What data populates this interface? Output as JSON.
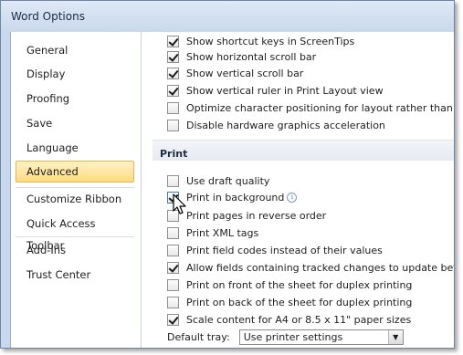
{
  "window": {
    "title": "Word Options"
  },
  "sidebar": {
    "items": [
      {
        "label": "General"
      },
      {
        "label": "Display"
      },
      {
        "label": "Proofing"
      },
      {
        "label": "Save"
      },
      {
        "label": "Language"
      },
      {
        "label": "Advanced",
        "selected": true
      },
      {
        "label": "Customize Ribbon"
      },
      {
        "label": "Quick Access Toolbar"
      },
      {
        "label": "Add-Ins"
      },
      {
        "label": "Trust Center"
      }
    ]
  },
  "display_options": [
    {
      "label": "Show shortcut keys in ScreenTips",
      "checked": true
    },
    {
      "label": "Show horizontal scroll bar",
      "checked": true
    },
    {
      "label": "Show vertical scroll bar",
      "checked": true
    },
    {
      "label": "Show vertical ruler in Print Layout view",
      "checked": true
    },
    {
      "label": "Optimize character positioning for layout rather than rea",
      "checked": false
    },
    {
      "label": "Disable hardware graphics acceleration",
      "checked": false
    }
  ],
  "print_section": {
    "title": "Print",
    "options": [
      {
        "label": "Use draft quality",
        "checked": false
      },
      {
        "label": "Print in background",
        "checked": true
      },
      {
        "label": "Print pages in reverse order",
        "checked": false
      },
      {
        "label": "Print XML tags",
        "checked": false
      },
      {
        "label": "Print field codes instead of their values",
        "checked": false
      },
      {
        "label": "Allow fields containing tracked changes to update befor",
        "checked": true
      },
      {
        "label": "Print on front of the sheet for duplex printing",
        "checked": false
      },
      {
        "label": "Print on back of the sheet for duplex printing",
        "checked": false
      },
      {
        "label": "Scale content for A4 or 8.5 x 11\" paper sizes",
        "checked": true
      }
    ],
    "default_tray": {
      "label": "Default tray:",
      "value": "Use printer settings"
    }
  },
  "colors": {
    "selected_bg": "#fedc82",
    "frame": "#c9d8ec"
  }
}
